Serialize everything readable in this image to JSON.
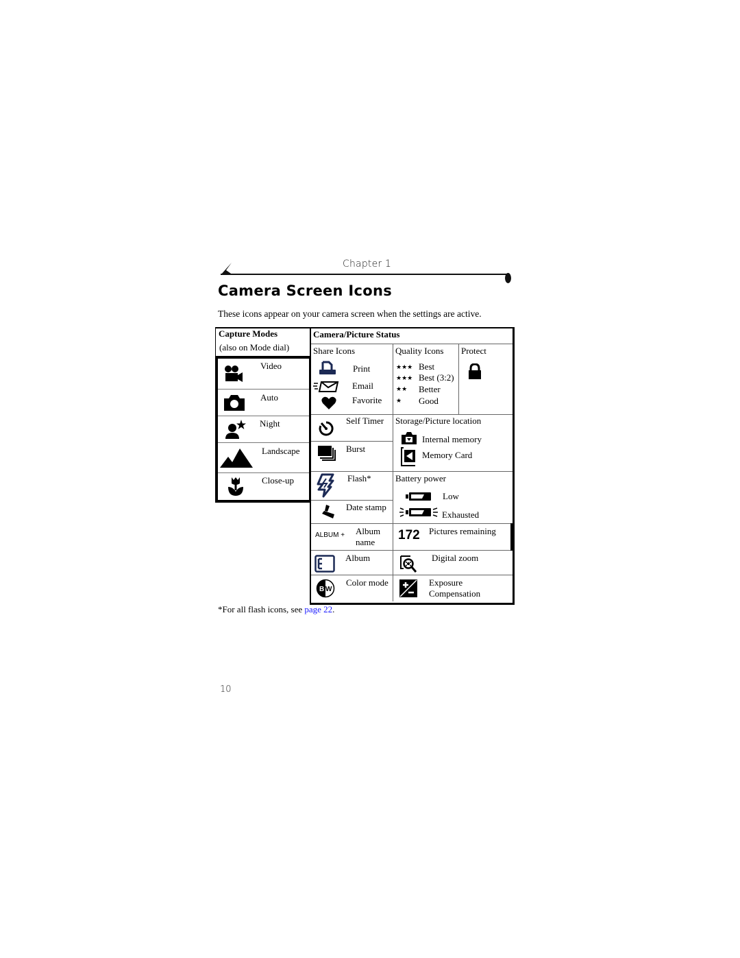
{
  "header": {
    "chapter_label": "Chapter 1",
    "title": "Camera Screen Icons",
    "intro": "These icons appear on your camera screen when the settings are active."
  },
  "capture_modes": {
    "title": "Capture Modes",
    "subtitle": "(also on Mode dial)",
    "items": [
      {
        "label": "Video",
        "icon": "video-camera-icon"
      },
      {
        "label": "Auto",
        "icon": "camera-icon"
      },
      {
        "label": "Night",
        "icon": "night-portrait-icon"
      },
      {
        "label": "Landscape",
        "icon": "mountains-icon"
      },
      {
        "label": "Close-up",
        "icon": "tulip-icon"
      }
    ]
  },
  "camera_status": {
    "title": "Camera/Picture Status",
    "share": {
      "title": "Share Icons",
      "items": [
        {
          "label": "Print",
          "icon": "printer-icon"
        },
        {
          "label": "Email",
          "icon": "envelope-icon"
        },
        {
          "label": "Favorite",
          "icon": "heart-icon"
        }
      ]
    },
    "quality": {
      "title": "Quality Icons",
      "items": [
        {
          "stars": "★★★",
          "label": "Best"
        },
        {
          "stars": "★★★",
          "label": "Best (3:2)"
        },
        {
          "stars": "★★",
          "label": "Better"
        },
        {
          "stars": "★",
          "label": "Good"
        }
      ]
    },
    "protect": {
      "title": "Protect",
      "icon": "lock-icon"
    },
    "self_timer": {
      "label": "Self Timer",
      "icon": "timer-icon"
    },
    "burst": {
      "label": "Burst",
      "icon": "burst-icon"
    },
    "flash": {
      "label": "Flash*",
      "icon": "flash-icon"
    },
    "date_stamp": {
      "label": "Date stamp",
      "icon": "stamp-icon"
    },
    "album_name": {
      "prefix": "ALBUM +",
      "label_line1": "Album",
      "label_line2": "name"
    },
    "album": {
      "label": "Album",
      "icon": "album-icon"
    },
    "color_mode": {
      "label": "Color mode",
      "icon": "bw-icon",
      "icon_text": "BW"
    },
    "storage": {
      "title": "Storage/Picture location",
      "items": [
        {
          "label": "Internal memory",
          "icon": "internal-memory-icon"
        },
        {
          "label": "Memory Card",
          "icon": "memory-card-icon"
        }
      ]
    },
    "battery": {
      "title": "Battery power",
      "items": [
        {
          "label": "Low",
          "icon": "battery-low-icon"
        },
        {
          "label": "Exhausted",
          "icon": "battery-exhausted-icon"
        }
      ]
    },
    "pictures_remaining": {
      "count": "172",
      "label": "Pictures remaining"
    },
    "digital_zoom": {
      "label": "Digital zoom",
      "icon": "zoom-icon"
    },
    "exposure": {
      "label_line1": "Exposure",
      "label_line2": "Compensation",
      "icon": "exposure-icon"
    }
  },
  "footnote": {
    "text": "*For all flash icons, see ",
    "link_text": "page 22",
    "link_color": "#1a1aff",
    "suffix": "."
  },
  "page_number": "10"
}
